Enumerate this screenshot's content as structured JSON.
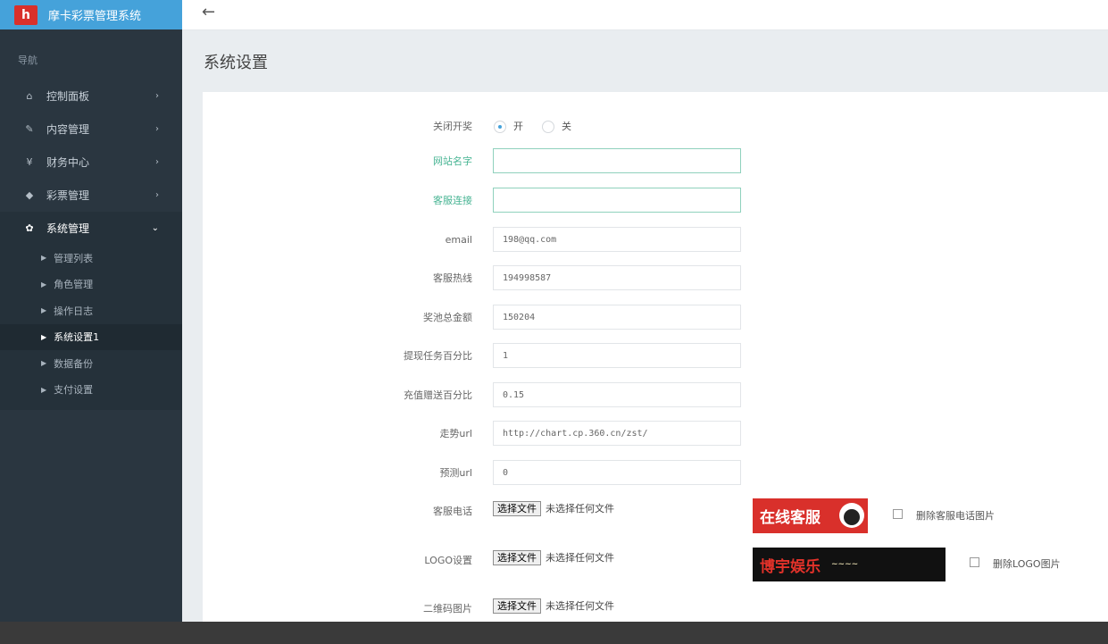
{
  "app": {
    "title": "摩卡彩票管理系统",
    "logo_text": "h"
  },
  "nav": {
    "caption": "导航",
    "items": [
      {
        "label": "控制面板",
        "icon": "home-icon"
      },
      {
        "label": "内容管理",
        "icon": "edit-icon"
      },
      {
        "label": "财务中心",
        "icon": "yen-icon"
      },
      {
        "label": "彩票管理",
        "icon": "ticket-icon"
      },
      {
        "label": "系统管理",
        "icon": "gear-icon"
      }
    ],
    "sub_items": [
      {
        "label": "管理列表"
      },
      {
        "label": "角色管理"
      },
      {
        "label": "操作日志"
      },
      {
        "label": "系统设置1"
      },
      {
        "label": "数据备份"
      },
      {
        "label": "支付设置"
      }
    ]
  },
  "header": {
    "back": "←"
  },
  "page": {
    "title": "系统设置"
  },
  "form": {
    "lottery_switch": {
      "label": "关闭开奖",
      "option_on": "开",
      "option_off": "关"
    },
    "site_name": {
      "label": "网站名字",
      "value": ""
    },
    "service_link": {
      "label": "客服连接",
      "value": ""
    },
    "email": {
      "label": "email",
      "value": "198@qq.com"
    },
    "hotline": {
      "label": "客服热线",
      "value": "194998587"
    },
    "pool_total": {
      "label": "奖池总金额",
      "value": "150204"
    },
    "withdraw_pct": {
      "label": "提现任务百分比",
      "value": "1"
    },
    "recharge_pct": {
      "label": "充值赠送百分比",
      "value": "0.15"
    },
    "trend_url": {
      "label": "走势url",
      "value": "http://chart.cp.360.cn/zst/"
    },
    "predict_url": {
      "label": "预测url",
      "value": "0"
    },
    "service_phone": {
      "label": "客服电话",
      "button": "选择文件",
      "status": "未选择任何文件",
      "delete_label": "删除客服电话图片",
      "image_text": "在线客服"
    },
    "logo": {
      "label": "LOGO设置",
      "button": "选择文件",
      "status": "未选择任何文件",
      "delete_label": "删除LOGO图片",
      "image_text": "博宇娱乐"
    },
    "qrcode": {
      "label": "二维码图片",
      "button": "选择文件",
      "status": "未选择任何文件"
    }
  },
  "colors": {
    "accent": "#45a2da",
    "sidebar": "#2a3640",
    "focus_green": "#8fd1bd",
    "brand_red": "#d9302b"
  }
}
